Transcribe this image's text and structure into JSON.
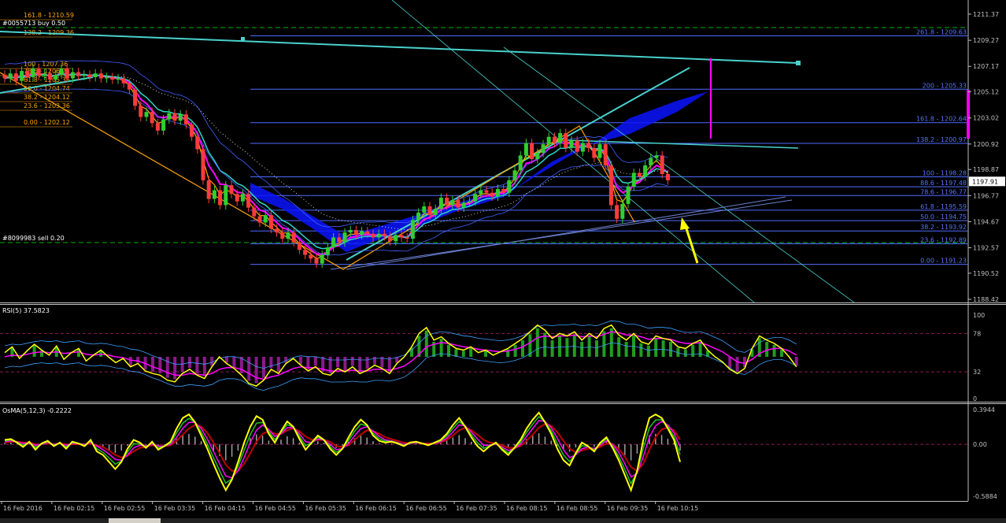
{
  "colors": {
    "background": "#000000",
    "axis": "#c0c0c0",
    "bull": "#32cd32",
    "bear": "#ff3b3b",
    "fib": "#4f6bff",
    "fib_label": "#5a73ff",
    "order_line": "#00b400",
    "trend": "#48d1cc",
    "cloud": "#0a14ff",
    "magenta": "#ff00ff",
    "orange": "#ffa500",
    "yellow": "#ffff00",
    "rsi_level": "#8b1a5a"
  },
  "chart_data": [
    {
      "type": "candlestick",
      "title": "",
      "ylim": [
        1188.42,
        1213.0
      ],
      "yticks": [
        "1211.37",
        "1209.27",
        "1207.17",
        "1205.12",
        "1203.02",
        "1200.92",
        "1198.87",
        "1196.77",
        "1194.67",
        "1192.57",
        "1190.52",
        "1188.42"
      ],
      "current_price": "1197.91",
      "order_labels": [
        "#0055713 buy 0.50",
        "#8099983 sell 0.20"
      ],
      "left_fib_labels": [
        "161.8 - 1210.59",
        "138.2 - 1209.36",
        "100 - 1207.36",
        "78.6 - 1206.24",
        "61.8 - 1205.36",
        "50.0 - 1204.74",
        "38.2 - 1204.12",
        "23.6 - 1203.36",
        "0.00 - 1202.12"
      ],
      "fib_levels": [
        {
          "label": "261.8 - 1209.63",
          "value": 1209.63
        },
        {
          "label": "200 - 1205.33",
          "value": 1205.33
        },
        {
          "label": "161.8 - 1202.64",
          "value": 1202.64
        },
        {
          "label": "138.2 - 1200.97",
          "value": 1200.97
        },
        {
          "label": "100 - 1198.28",
          "value": 1198.28
        },
        {
          "label": "88.6 - 1197.48",
          "value": 1197.48
        },
        {
          "label": "78.6 - 1196.77",
          "value": 1196.77
        },
        {
          "label": "61.8 - 1195.59",
          "value": 1195.59
        },
        {
          "label": "50.0 - 1194.75",
          "value": 1194.75
        },
        {
          "label": "38.2 - 1193.92",
          "value": 1193.92
        },
        {
          "label": "23.6 - 1192.89",
          "value": 1192.89
        },
        {
          "label": "0.00 - 1191.23",
          "value": 1191.23
        }
      ],
      "close": [
        1206.2,
        1206.6,
        1206.0,
        1206.8,
        1206.3,
        1207.0,
        1206.4,
        1206.6,
        1206.1,
        1206.5,
        1207.0,
        1206.2,
        1206.7,
        1206.4,
        1206.5,
        1206.3,
        1206.6,
        1206.2,
        1206.3,
        1206.1,
        1206.2,
        1205.8,
        1205.3,
        1204.0,
        1203.1,
        1203.5,
        1202.6,
        1202.0,
        1202.9,
        1203.4,
        1202.8,
        1203.3,
        1202.5,
        1201.5,
        1200.5,
        1198.0,
        1196.5,
        1197.2,
        1196.0,
        1197.6,
        1196.9,
        1196.3,
        1196.9,
        1195.8,
        1195.1,
        1194.6,
        1195.2,
        1194.1,
        1193.8,
        1193.3,
        1193.8,
        1193.0,
        1192.4,
        1192.0,
        1191.7,
        1191.3,
        1192.0,
        1192.6,
        1193.4,
        1193.0,
        1193.8,
        1194.0,
        1193.6,
        1193.9,
        1193.7,
        1193.4,
        1193.7,
        1193.5,
        1193.1,
        1193.6,
        1193.4,
        1193.3,
        1194.8,
        1195.4,
        1195.9,
        1195.2,
        1195.7,
        1196.6,
        1196.0,
        1196.4,
        1195.8,
        1196.2,
        1196.3,
        1196.9,
        1197.2,
        1197.0,
        1196.7,
        1197.3,
        1197.0,
        1198.0,
        1198.8,
        1200.0,
        1201.0,
        1199.7,
        1200.2,
        1200.9,
        1201.5,
        1201.0,
        1201.8,
        1200.6,
        1201.2,
        1200.3,
        1201.0,
        1200.6,
        1199.8,
        1200.9,
        1199.2,
        1196.0,
        1194.9,
        1196.1,
        1197.5,
        1198.6,
        1198.3,
        1199.2,
        1199.8,
        1200.0,
        1198.5,
        1198.0
      ]
    },
    {
      "type": "line",
      "title": "RSI(5) 37.5823",
      "ylim": [
        0,
        100
      ],
      "yticks": [
        "100",
        "78",
        "32",
        "0"
      ],
      "levels": [
        78,
        32
      ],
      "rsi": [
        55,
        62,
        48,
        57,
        65,
        58,
        52,
        63,
        47,
        55,
        60,
        45,
        52,
        58,
        50,
        43,
        48,
        38,
        42,
        33,
        30,
        28,
        22,
        20,
        30,
        35,
        28,
        24,
        38,
        50,
        42,
        36,
        28,
        18,
        15,
        22,
        35,
        30,
        42,
        48,
        40,
        33,
        38,
        30,
        28,
        36,
        32,
        38,
        30,
        34,
        40,
        36,
        30,
        42,
        50,
        62,
        78,
        85,
        70,
        74,
        66,
        60,
        58,
        62,
        55,
        58,
        52,
        56,
        60,
        66,
        72,
        80,
        88,
        82,
        72,
        78,
        75,
        80,
        70,
        78,
        72,
        84,
        88,
        76,
        70,
        78,
        68,
        65,
        75,
        72,
        70,
        62,
        60,
        66,
        70,
        58,
        50,
        44,
        35,
        30,
        36,
        60,
        75,
        70,
        66,
        60,
        50,
        38
      ],
      "signal": [
        50,
        52,
        51,
        53,
        55,
        56,
        55,
        56,
        54,
        55,
        56,
        53,
        52,
        53,
        52,
        50,
        49,
        46,
        45,
        42,
        38,
        35,
        31,
        28,
        28,
        30,
        29,
        28,
        30,
        35,
        37,
        37,
        35,
        30,
        25,
        23,
        26,
        28,
        32,
        36,
        38,
        37,
        37,
        35,
        33,
        33,
        33,
        34,
        33,
        33,
        35,
        35,
        34,
        36,
        39,
        45,
        53,
        62,
        65,
        67,
        66,
        64,
        62,
        61,
        59,
        58,
        57,
        56,
        57,
        59,
        62,
        67,
        73,
        75,
        74,
        75,
        75,
        76,
        74,
        75,
        74,
        77,
        80,
        79,
        76,
        76,
        74,
        71,
        72,
        72,
        71,
        68,
        66,
        66,
        67,
        64,
        60,
        56,
        50,
        44,
        42,
        47,
        54,
        58,
        60,
        60,
        57,
        52
      ]
    },
    {
      "type": "histogram",
      "title": "OsMA(5,12,3) -0.2222",
      "ylim": [
        -0.5884,
        0.3944
      ],
      "yticks": [
        "0.3944",
        "0.00",
        "-0.5884"
      ],
      "osma": [
        0.05,
        0.06,
        0.02,
        -0.03,
        0.03,
        -0.06,
        0.01,
        0.04,
        -0.02,
        0.02,
        -0.05,
        0.03,
        0.01,
        -0.02,
        0.05,
        -0.08,
        -0.12,
        -0.2,
        -0.28,
        -0.2,
        -0.05,
        0.05,
        0.02,
        -0.04,
        0.03,
        -0.06,
        -0.02,
        0.03,
        0.18,
        0.3,
        0.34,
        0.25,
        0.1,
        -0.05,
        -0.22,
        -0.38,
        -0.52,
        -0.4,
        -0.2,
        0.02,
        0.2,
        0.32,
        0.28,
        0.12,
        0.02,
        0.15,
        0.26,
        0.2,
        0.06,
        -0.06,
        0.02,
        0.1,
        0.05,
        -0.05,
        -0.12,
        -0.05,
        0.08,
        0.2,
        0.28,
        0.22,
        0.1,
        0.04,
        0.02,
        0.03,
        0.01,
        -0.02,
        0.02,
        0.03,
        0.01,
        -0.01,
        0.02,
        0.05,
        0.12,
        0.22,
        0.3,
        0.2,
        0.08,
        -0.02,
        -0.08,
        -0.02,
        0.02,
        -0.06,
        -0.12,
        -0.04,
        0.05,
        0.18,
        0.28,
        0.36,
        0.25,
        0.12,
        -0.05,
        -0.18,
        -0.24,
        -0.1,
        0.02,
        -0.02,
        -0.08,
        0.02,
        0.08,
        -0.04,
        -0.18,
        -0.35,
        -0.52,
        -0.3,
        0.05,
        0.3,
        0.34,
        0.3,
        0.18,
        0.05,
        -0.2
      ],
      "sig1": [
        0.03,
        0.04,
        0.03,
        0.01,
        0.02,
        -0.01,
        0.0,
        0.02,
        0.0,
        0.01,
        -0.01,
        0.01,
        0.01,
        0.0,
        0.02,
        -0.02,
        -0.06,
        -0.11,
        -0.17,
        -0.18,
        -0.12,
        -0.04,
        -0.01,
        -0.02,
        0.0,
        -0.02,
        -0.02,
        0.0,
        0.08,
        0.18,
        0.25,
        0.25,
        0.18,
        0.06,
        -0.08,
        -0.22,
        -0.36,
        -0.38,
        -0.3,
        -0.15,
        0.02,
        0.16,
        0.22,
        0.17,
        0.09,
        0.12,
        0.19,
        0.19,
        0.12,
        0.03,
        0.02,
        0.06,
        0.05,
        0.0,
        -0.06,
        -0.05,
        0.01,
        0.1,
        0.18,
        0.2,
        0.15,
        0.09,
        0.05,
        0.04,
        0.02,
        0.0,
        0.01,
        0.02,
        0.01,
        0.0,
        0.01,
        0.03,
        0.07,
        0.14,
        0.22,
        0.21,
        0.14,
        0.06,
        -0.01,
        -0.01,
        0.0,
        -0.03,
        -0.07,
        -0.05,
        0.0,
        0.09,
        0.18,
        0.27,
        0.26,
        0.19,
        0.07,
        -0.06,
        -0.15,
        -0.12,
        -0.05,
        -0.03,
        -0.05,
        -0.01,
        0.04,
        0.0,
        -0.09,
        -0.22,
        -0.37,
        -0.33,
        -0.14,
        0.08,
        0.21,
        0.26,
        0.22,
        0.13,
        -0.03
      ],
      "sig2": [
        0.02,
        0.03,
        0.03,
        0.02,
        0.02,
        0.0,
        0.0,
        0.01,
        0.0,
        0.01,
        0.0,
        0.0,
        0.0,
        0.0,
        0.01,
        -0.01,
        -0.03,
        -0.07,
        -0.12,
        -0.15,
        -0.13,
        -0.08,
        -0.04,
        -0.03,
        -0.01,
        -0.02,
        -0.02,
        -0.01,
        0.04,
        0.11,
        0.18,
        0.22,
        0.2,
        0.13,
        0.02,
        -0.1,
        -0.23,
        -0.3,
        -0.3,
        -0.22,
        -0.1,
        0.03,
        0.12,
        0.15,
        0.12,
        0.12,
        0.16,
        0.18,
        0.15,
        0.09,
        0.05,
        0.05,
        0.05,
        0.03,
        -0.02,
        -0.03,
        -0.01,
        0.05,
        0.11,
        0.16,
        0.15,
        0.12,
        0.08,
        0.06,
        0.04,
        0.02,
        0.01,
        0.02,
        0.01,
        0.01,
        0.01,
        0.02,
        0.05,
        0.1,
        0.16,
        0.19,
        0.16,
        0.11,
        0.05,
        0.02,
        0.01,
        -0.01,
        -0.04,
        -0.04,
        -0.02,
        0.04,
        0.11,
        0.19,
        0.23,
        0.21,
        0.14,
        0.04,
        -0.05,
        -0.09,
        -0.07,
        -0.05,
        -0.05,
        -0.03,
        0.01,
        0.0,
        -0.05,
        -0.14,
        -0.26,
        -0.3,
        -0.22,
        -0.06,
        0.08,
        0.17,
        0.19,
        0.16,
        0.05
      ],
      "xticks": [
        "16 Feb 2016",
        "16 Feb 02:15",
        "16 Feb 02:55",
        "16 Feb 03:35",
        "16 Feb 04:15",
        "16 Feb 04:55",
        "16 Feb 05:35",
        "16 Feb 06:15",
        "16 Feb 06:55",
        "16 Feb 07:35",
        "16 Feb 08:15",
        "16 Feb 08:55",
        "16 Feb 09:35",
        "16 Feb 10:15"
      ]
    }
  ]
}
